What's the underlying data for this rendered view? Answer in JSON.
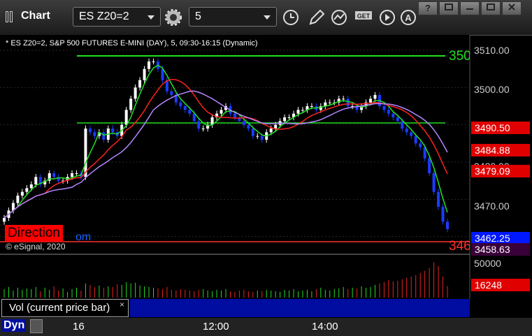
{
  "window": {
    "title": "Chart"
  },
  "toolbar": {
    "symbol": "ES Z20=2",
    "interval": "5"
  },
  "window_buttons": [
    "?",
    "",
    ""
  ],
  "legend": "* ES Z20=2, S&P 500 FUTURES E-MINI (DAY), 5, 09:30-16:15 (Dynamic)",
  "copyright": "© eSignal, 2020",
  "direction_label": "Direction",
  "direction_tail": "om",
  "volume_panel": {
    "label": "Vol (current price bar)",
    "close": "×"
  },
  "bottom": {
    "dyn": "Dyn",
    "time_labels": [
      "16",
      "12:00",
      "14:00"
    ]
  },
  "price_axis": [
    "3510.00",
    "3500.00",
    "3480.00",
    "3470.00"
  ],
  "price_tags": [
    {
      "value": "3490.50",
      "color": "#e00000"
    },
    {
      "value": "3484.88",
      "color": "#e00000"
    },
    {
      "value": "3479.09",
      "color": "#e00000"
    },
    {
      "value": "3462.25",
      "color": "#0018ff"
    },
    {
      "value": "3458.63",
      "color": "#3a003a"
    }
  ],
  "volume_axis": [
    "50000"
  ],
  "volume_tag": {
    "value": "16248",
    "color": "#e00000"
  },
  "right_edge_labels": [
    "350",
    "346"
  ],
  "colors": {
    "up": "#ffffff",
    "down": "#1a3cff",
    "ma_red": "#ff2020",
    "ma_green": "#22e022",
    "ma_purple": "#b488ff",
    "level_green": "#22e022",
    "level_red": "#ff3030",
    "vol_up": "#22dd22",
    "vol_down": "#ee2222"
  },
  "chart_data": {
    "type": "line",
    "title": "* ES Z20=2, S&P 500 FUTURES E-MINI (DAY), 5, 09:30-16:15 (Dynamic)",
    "series": [
      {
        "values": [
          3465,
          3467,
          3469,
          3471,
          3472,
          3473,
          3474,
          3476,
          3474,
          3475,
          3477,
          3476,
          3475,
          3475,
          3476,
          3477,
          3477,
          3476,
          3489,
          3488,
          3487,
          3488,
          3486,
          3489,
          3488,
          3487,
          3490,
          3494,
          3497,
          3500,
          3502,
          3505,
          3507,
          3507,
          3505,
          3502,
          3499,
          3498,
          3496,
          3495,
          3494,
          3493,
          3491,
          3489,
          3489,
          3490,
          3492,
          3493,
          3494,
          3495,
          3493,
          3492,
          3491,
          3490,
          3489,
          3487,
          3487,
          3486,
          3488,
          3489,
          3490,
          3491,
          3492,
          3492,
          3493,
          3494,
          3494,
          3495,
          3495,
          3494,
          3495,
          3496,
          3496,
          3496,
          3497,
          3497,
          3495,
          3495,
          3494,
          3495,
          3496,
          3497,
          3498,
          3495,
          3494,
          3493,
          3492,
          3491,
          3489,
          3488,
          3487,
          3485,
          3484,
          3481,
          3477,
          3472,
          3468,
          3464,
          3462
        ]
      }
    ],
    "levels": [
      3508.5,
      3490.5,
      3458.63
    ],
    "ylim": [
      3456,
      3513
    ],
    "y_ticks": [
      3510,
      3500,
      3490,
      3480,
      3470,
      3460
    ],
    "x_tick_labels": [
      "16",
      "12:00",
      "14:00"
    ],
    "volume": {
      "max": 50000,
      "last": 16248,
      "values": [
        12000,
        15000,
        10000,
        14000,
        11000,
        13000,
        12000,
        15000,
        9000,
        14000,
        11000,
        16000,
        10000,
        13000,
        8000,
        12000,
        14000,
        10000,
        20000,
        18000,
        15000,
        17000,
        14000,
        16000,
        15000,
        19000,
        18000,
        22000,
        20000,
        21000,
        17000,
        16000,
        15000,
        14000,
        13000,
        12000,
        15000,
        11000,
        10000,
        12000,
        11000,
        10000,
        9000,
        11000,
        12000,
        10000,
        9000,
        11000,
        10000,
        12000,
        9000,
        8000,
        10000,
        11000,
        9000,
        8000,
        10000,
        9000,
        11000,
        10000,
        9000,
        8000,
        11000,
        10000,
        12000,
        9000,
        10000,
        11000,
        9000,
        12000,
        14000,
        11000,
        10000,
        12000,
        13000,
        15000,
        12000,
        14000,
        13000,
        16000,
        14000,
        15000,
        18000,
        20000,
        22000,
        25000,
        23000,
        24000,
        26000,
        28000,
        30000,
        32000,
        35000,
        38000,
        42000,
        50000,
        45000,
        30000,
        16248
      ]
    }
  }
}
